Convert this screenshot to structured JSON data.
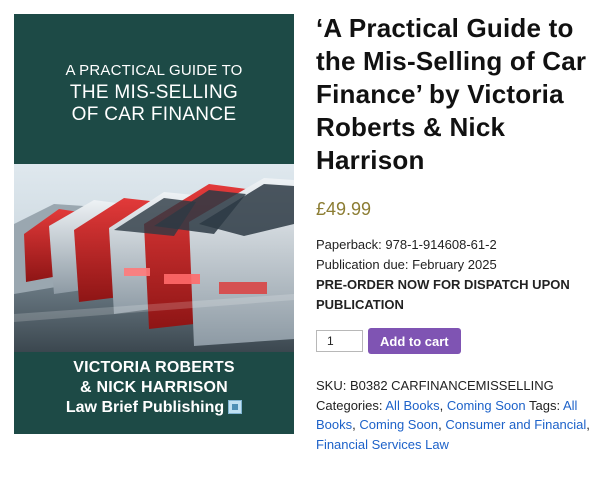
{
  "cover": {
    "top_line": "A PRACTICAL GUIDE TO",
    "title_line_1": "THE MIS-SELLING",
    "title_line_2": "OF CAR FINANCE",
    "author_line_1": "VICTORIA ROBERTS",
    "author_line_2": "& NICK HARRISON",
    "publisher": "Law Brief Publishing",
    "background_color": "#1d4a46"
  },
  "product": {
    "title": "‘A Practical Guide to the Mis-Selling of Car Finance’ by Victoria Roberts & Nick Harrison",
    "price": "£49.99",
    "price_color": "#8c7d33",
    "paperback": "Paperback: 978-1-914608-61-2",
    "publication": "Publication due: February 2025",
    "preorder_line_1": "PRE-ORDER NOW FOR DISPATCH UPON",
    "preorder_line_2": "PUBLICATION"
  },
  "cart": {
    "quantity": "1",
    "add_label": "Add to cart",
    "button_color": "#7f54b3"
  },
  "meta": {
    "sku_label": "SKU:",
    "sku": "B0382 CARFINANCEMISSELLING",
    "categories_label": "Categories:",
    "categories": [
      "All Books",
      "Coming Soon"
    ],
    "tags_label": "Tags:",
    "tags": [
      "All Books",
      "Coming Soon",
      "Consumer and Financial",
      "Financial Services Law"
    ],
    "link_color": "#1d62c9"
  }
}
